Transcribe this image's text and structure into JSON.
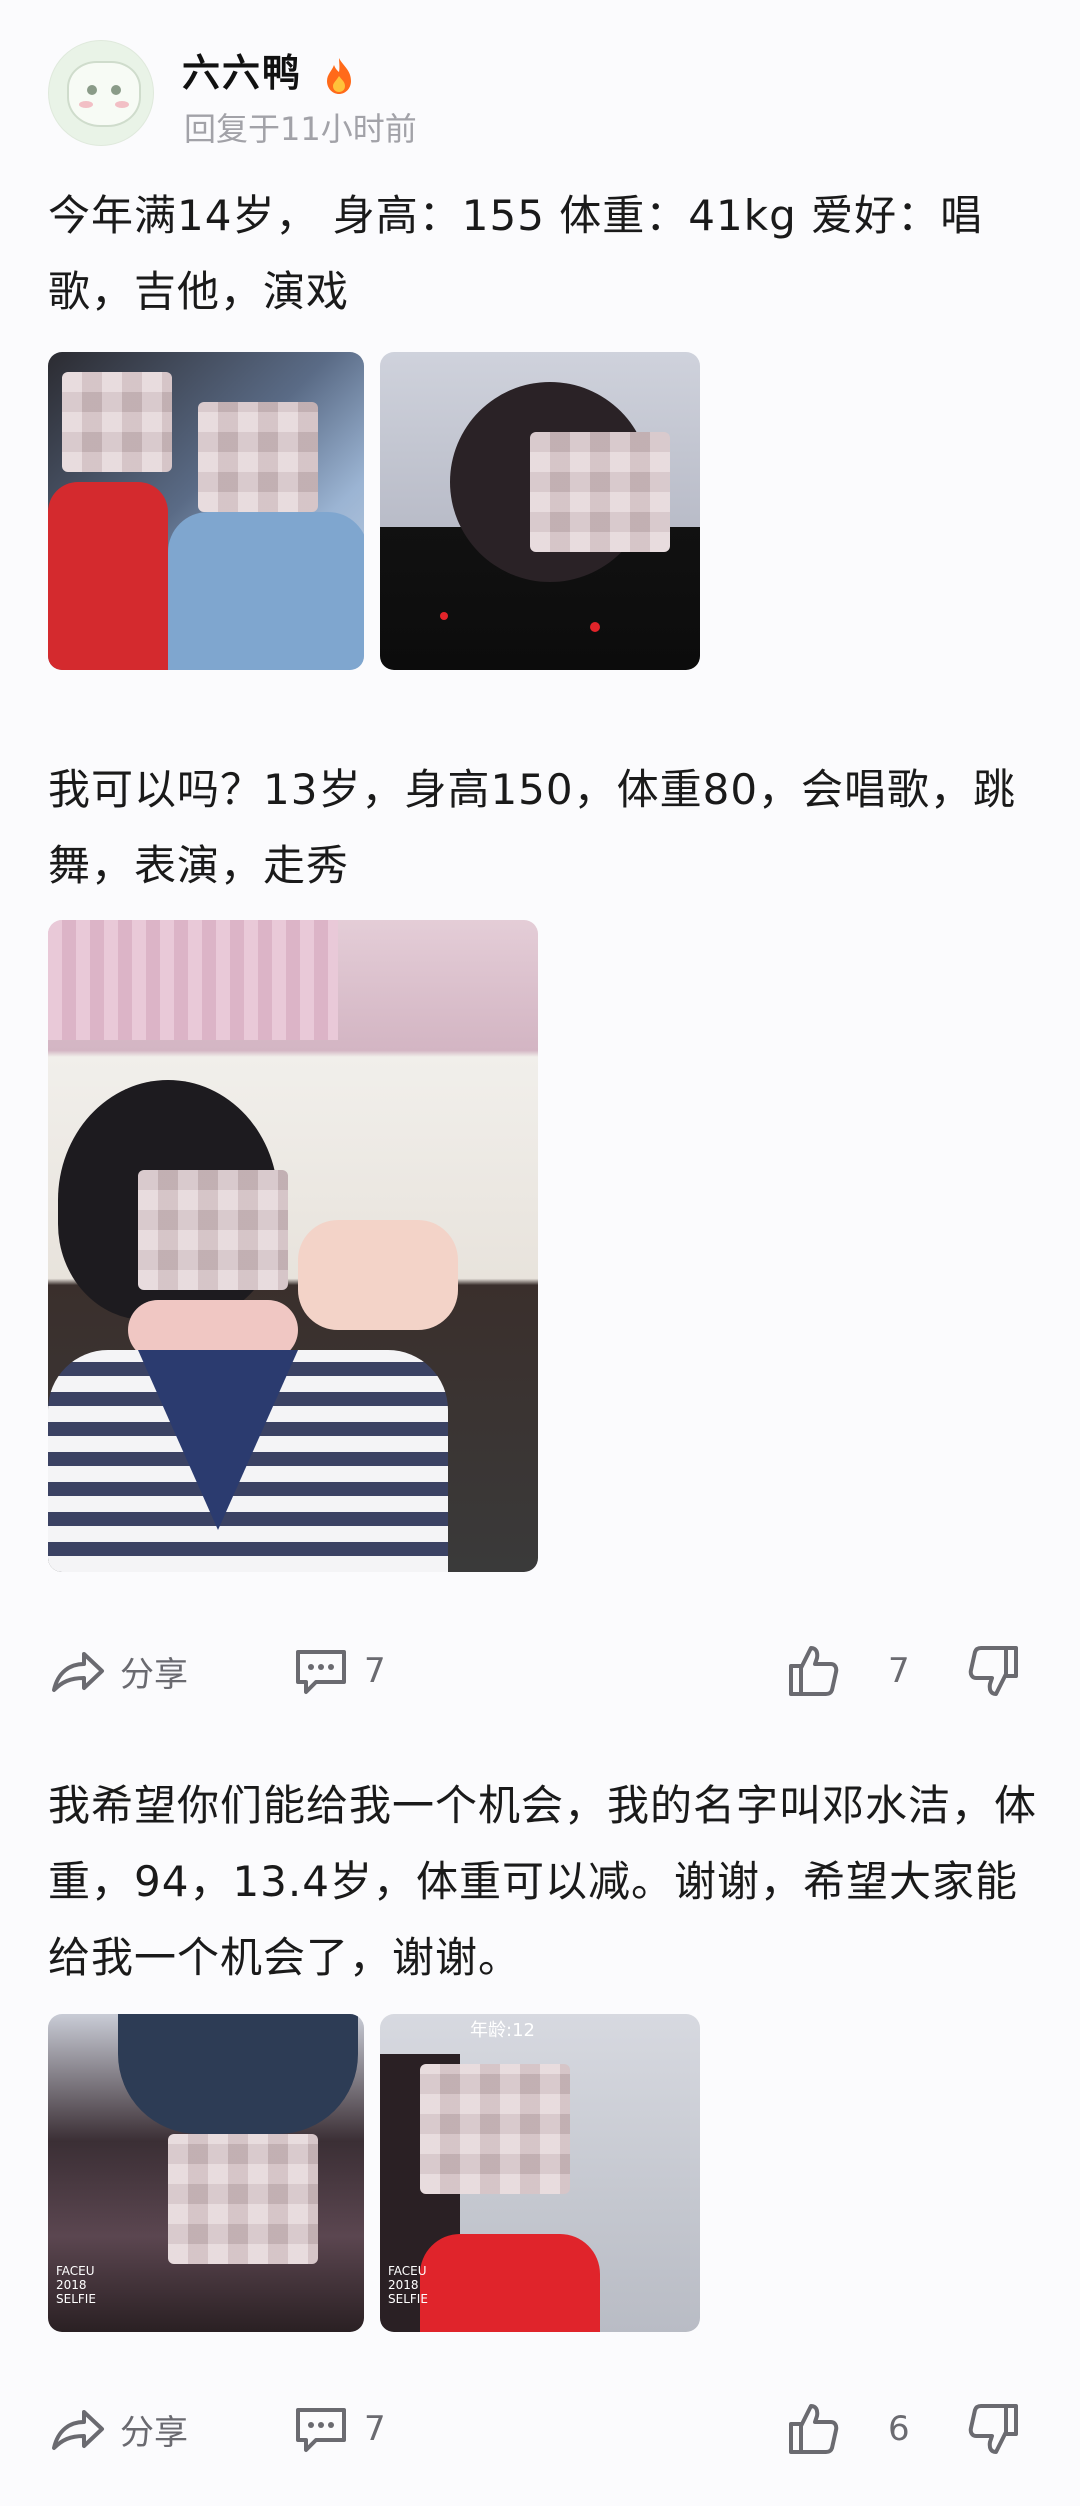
{
  "user": {
    "name": "六六鸭",
    "reply_time": "回复于11小时前"
  },
  "comments": [
    {
      "text": "今年满14岁，  身高：155 体重：41kg 爱好：唱歌，吉他，演戏"
    },
    {
      "text": "我可以吗？13岁，身高150，体重80，会唱歌，跳舞，表演，走秀"
    },
    {
      "text": "我希望你们能给我一个机会，我的名字叫邓水洁，体重，94，13.4岁，体重可以减。谢谢，希望大家能给我一个机会了，谢谢。"
    }
  ],
  "photo_overlays": {
    "faceu_stamp": "FACEU\n2018\nSELFIE",
    "age_tag": "年龄:12"
  },
  "action_bars": [
    {
      "share_label": "分享",
      "comment_count": "7",
      "like_count": "7"
    },
    {
      "share_label": "分享",
      "comment_count": "7",
      "like_count": "6"
    }
  ],
  "icons": {
    "share": "share-arrow-icon",
    "comment": "speech-bubble-icon",
    "like": "thumbs-up-icon",
    "dislike": "thumbs-down-icon",
    "hot": "fire-icon"
  },
  "colors": {
    "background": "#fbfbfd",
    "text": "#1a1a1a",
    "muted": "#a2a2a8",
    "icon": "#6a6a70"
  }
}
